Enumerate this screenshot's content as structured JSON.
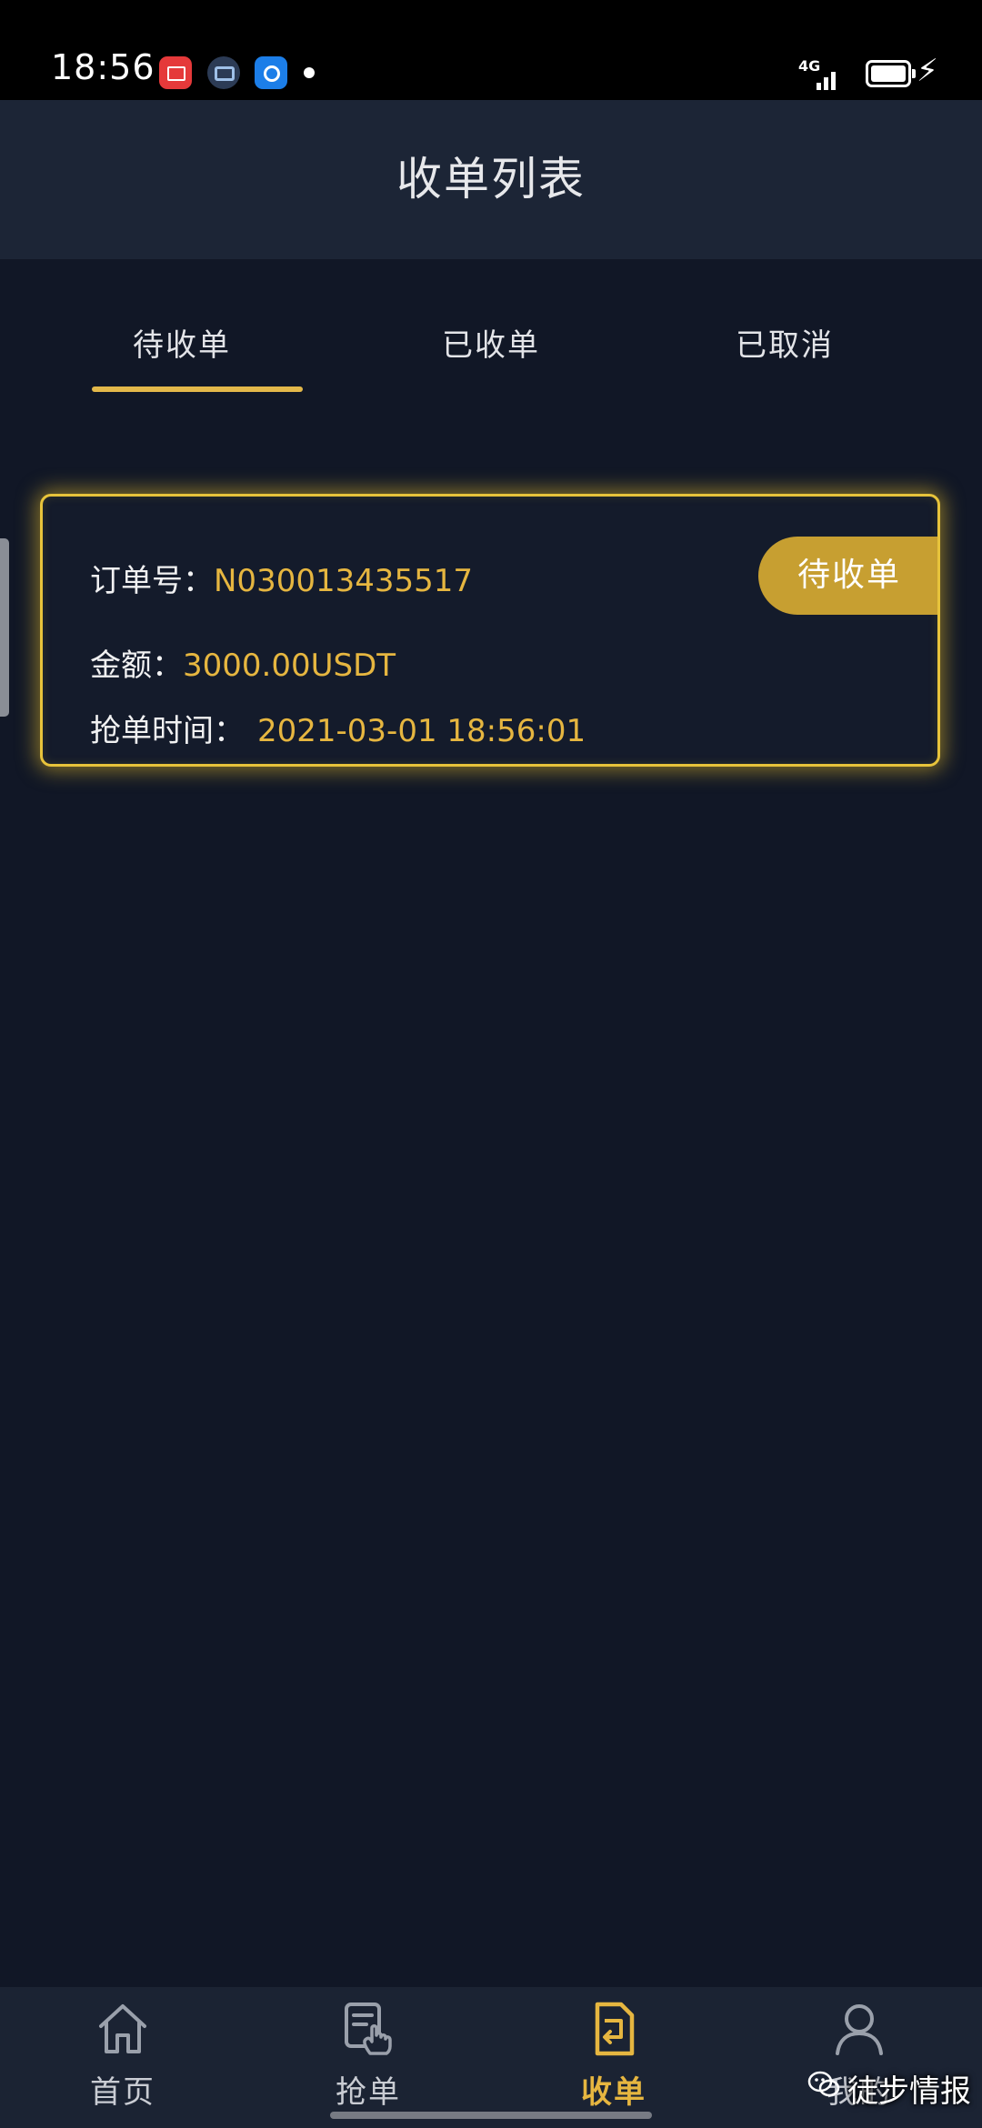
{
  "status_bar": {
    "time": "18:56",
    "network": "4G"
  },
  "header": {
    "title": "收单列表"
  },
  "tabs": [
    {
      "label": "待收单",
      "active": true
    },
    {
      "label": "已收单",
      "active": false
    },
    {
      "label": "已取消",
      "active": false
    }
  ],
  "order": {
    "order_no_label": "订单号：",
    "order_no": "N030013435517",
    "amount_label": "金额：",
    "amount": "3000.00USDT",
    "time_label": "抢单时间：",
    "time": "2021-03-01 18:56:01",
    "status": "待收单"
  },
  "bottom_nav": [
    {
      "label": "首页",
      "icon": "home-icon",
      "active": false
    },
    {
      "label": "抢单",
      "icon": "grab-order-icon",
      "active": false
    },
    {
      "label": "收单",
      "icon": "receive-order-icon",
      "active": true
    },
    {
      "label": "我的",
      "icon": "user-icon",
      "active": false
    }
  ],
  "watermark": {
    "text": "徒步情报",
    "icon": "wechat-icon"
  },
  "colors": {
    "background": "#111726",
    "header": "#1c2536",
    "accent": "#e6b640",
    "card_border": "#e7c33b",
    "pill": "#c79f31"
  }
}
